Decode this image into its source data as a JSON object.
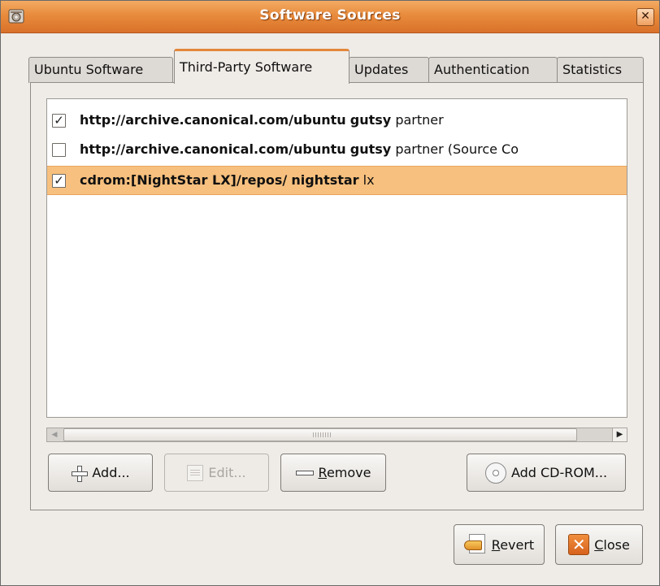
{
  "window": {
    "title": "Software Sources"
  },
  "tabs": [
    {
      "label": "Ubuntu Software"
    },
    {
      "label": "Third-Party Software"
    },
    {
      "label": "Updates"
    },
    {
      "label": "Authentication"
    },
    {
      "label": "Statistics"
    }
  ],
  "sources": [
    {
      "checked": true,
      "uri": "http://archive.canonical.com/ubuntu",
      "dist": "gutsy",
      "components": "partner"
    },
    {
      "checked": false,
      "uri": "http://archive.canonical.com/ubuntu",
      "dist": "gutsy",
      "components": "partner (Source Co"
    },
    {
      "checked": true,
      "uri": "cdrom:[NightStar LX]/repos/",
      "dist": "nightstar",
      "components": "lx"
    }
  ],
  "buttons": {
    "add": "Add...",
    "edit": "Edit...",
    "remove_accel": "R",
    "remove_rest": "emove",
    "add_cdrom": "Add CD-ROM...",
    "revert_accel": "R",
    "revert_rest": "evert",
    "close_accel": "C",
    "close_rest": "lose"
  },
  "icons": {
    "window": "software-properties-icon",
    "close": "close-icon",
    "add": "plus-icon",
    "edit": "edit-icon",
    "remove": "minus-icon",
    "cdrom": "cdrom-icon",
    "revert": "revert-icon",
    "close_button": "close-x-icon"
  },
  "checkmark": "✓"
}
